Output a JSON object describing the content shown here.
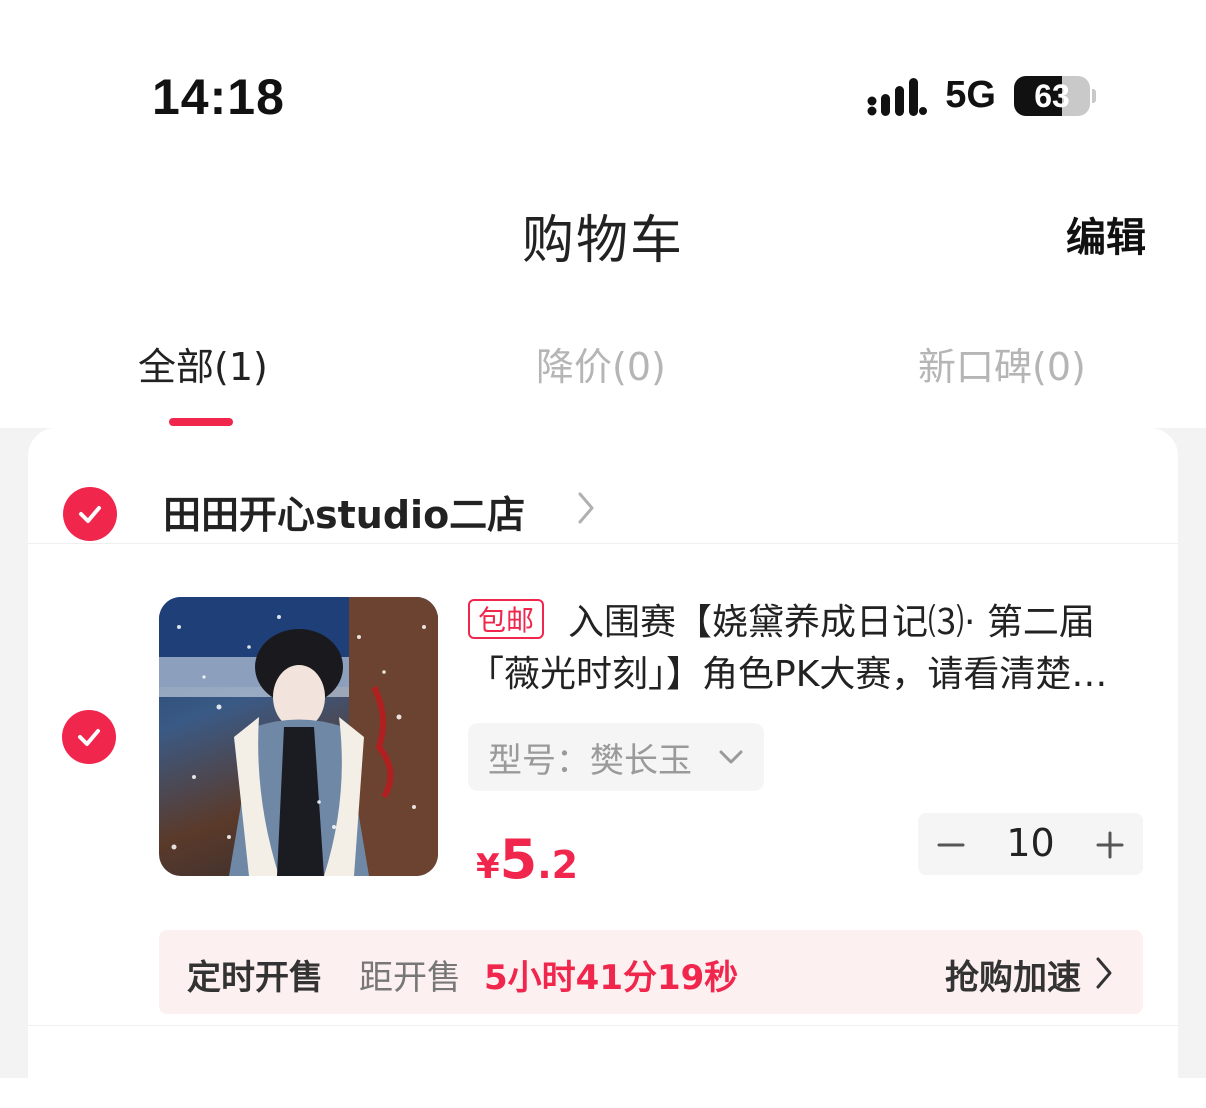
{
  "status_bar": {
    "time": "14:18",
    "network": "5G",
    "battery": "63",
    "battery_level": 0.63
  },
  "header": {
    "title": "购物车",
    "edit": "编辑"
  },
  "tabs": [
    {
      "label": "全部(1)",
      "active": true
    },
    {
      "label": "降价(0)",
      "active": false
    },
    {
      "label": "新口碑(0)",
      "active": false
    }
  ],
  "shop": {
    "name": "田田开心studio二店",
    "checked": true,
    "item": {
      "checked": true,
      "badge": "包邮",
      "title": "入围赛【娆黛养成日记⑶· 第二届「薇光时刻」】角色PK大赛，请看清楚规则",
      "variant": "型号：樊长玉",
      "price": {
        "currency": "¥",
        "integer": "5",
        "decimal": ".2"
      },
      "quantity": "10"
    },
    "presale": {
      "label": "定时开售",
      "countdown_label": "距开售",
      "countdown": "5小时41分19秒",
      "action": "抢购加速"
    }
  },
  "colors": {
    "accent": "#f0264d",
    "presale_bg": "#fdf0f0"
  }
}
